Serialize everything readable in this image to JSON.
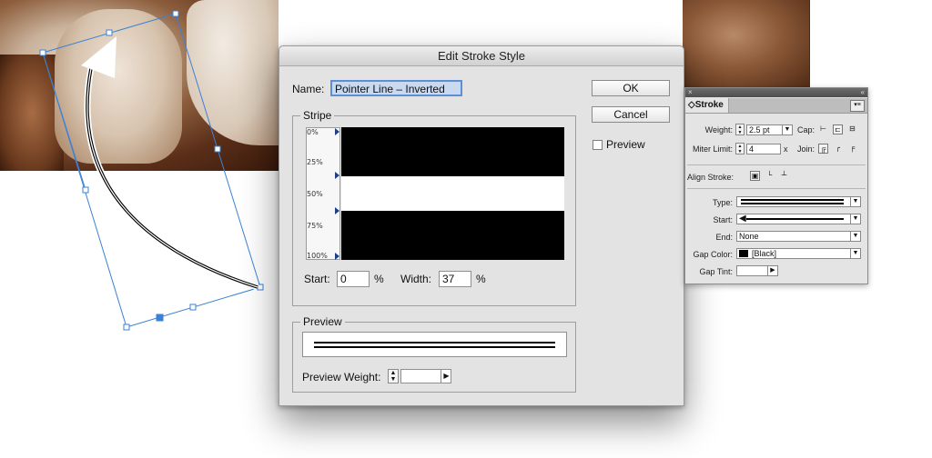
{
  "dialog": {
    "title": "Edit Stroke Style",
    "name_label": "Name:",
    "name_value": "Pointer Line – Inverted",
    "ok_label": "OK",
    "cancel_label": "Cancel",
    "preview_checkbox_label": "Preview",
    "preview_checked": false,
    "stripe": {
      "title": "Stripe",
      "ruler_ticks": [
        "0%",
        "25%",
        "50%",
        "75%",
        "100%"
      ],
      "stripes": [
        {
          "start": 0,
          "width": 37
        },
        {
          "start": 63,
          "width": 37
        }
      ],
      "start_label": "Start:",
      "start_value": "0",
      "width_label": "Width:",
      "width_value": "37",
      "percent": "%"
    },
    "preview": {
      "title": "Preview",
      "weight_label": "Preview Weight:",
      "weight_value": ""
    }
  },
  "stroke_panel": {
    "tab_label": "Stroke",
    "weight_label": "Weight:",
    "weight_value": "2.5 pt",
    "cap_label": "Cap:",
    "miter_label": "Miter Limit:",
    "miter_value": "4",
    "x_label": "x",
    "join_label": "Join:",
    "align_label": "Align Stroke:",
    "type_label": "Type:",
    "start_label": "Start:",
    "end_label": "End:",
    "end_value": "None",
    "gap_color_label": "Gap Color:",
    "gap_color_value": "[Black]",
    "gap_tint_label": "Gap Tint:",
    "gap_tint_value": ""
  },
  "colors": {
    "selection": "#3b82d6",
    "dialog_bg": "#e3e3e3",
    "stripe_ink": "#000000"
  }
}
